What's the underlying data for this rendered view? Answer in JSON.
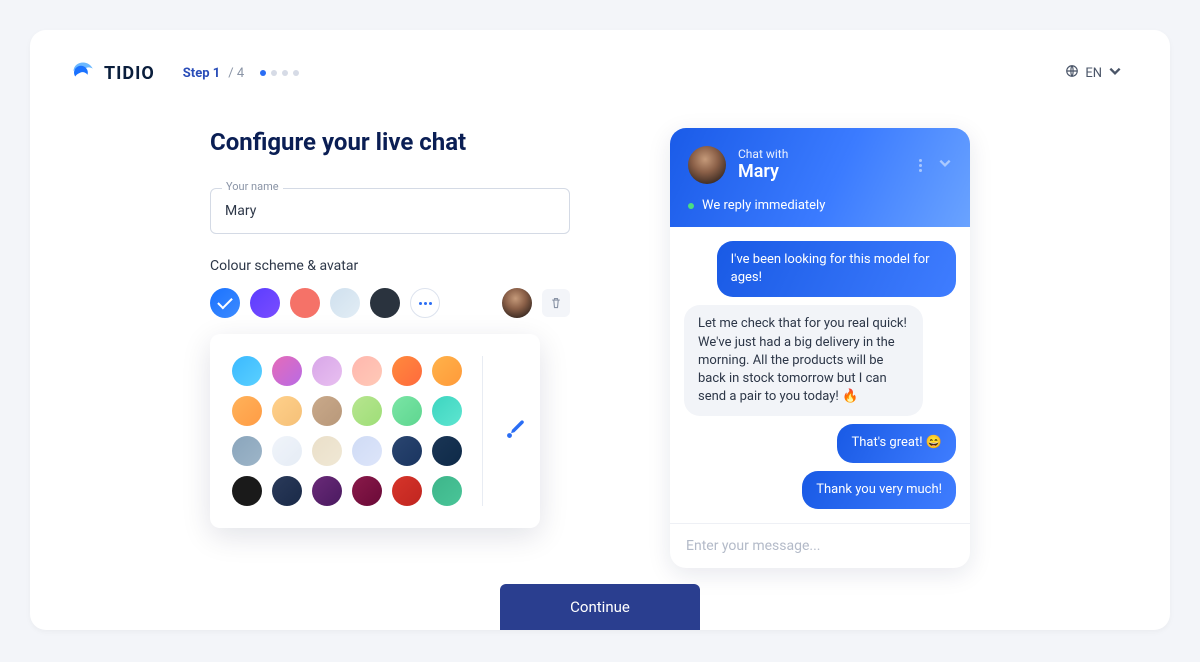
{
  "brand": "TIDIO",
  "step": {
    "label": "Step 1",
    "total": "/ 4",
    "current": 1,
    "count": 4
  },
  "lang": "EN",
  "heading": "Configure your live chat",
  "nameField": {
    "label": "Your name",
    "value": "Mary"
  },
  "colourLabel": "Colour scheme & avatar",
  "primarySwatches": [
    {
      "css": "linear-gradient(135deg,#1a72ff,#3d8bff)",
      "selected": true
    },
    {
      "css": "linear-gradient(135deg,#5b3dff,#7a4dff)"
    },
    {
      "css": "#f57268"
    },
    {
      "css": "linear-gradient(135deg,#cfe0ee,#e2edf5)"
    },
    {
      "css": "#2a333e"
    }
  ],
  "paletteSwatches": [
    "linear-gradient(135deg,#3bb9ff,#5ad0ff)",
    "linear-gradient(135deg,#e56bb8,#b86be5)",
    "linear-gradient(135deg,#d8a6e8,#e8bff0)",
    "linear-gradient(135deg,#ffb7ae,#ffc9b7)",
    "linear-gradient(135deg,#ff8a3d,#ff6a3d)",
    "linear-gradient(135deg,#ffb24a,#ff9a3a)",
    "linear-gradient(135deg,#ffb25a,#ff9c45)",
    "linear-gradient(135deg,#ffd08a,#f5c078)",
    "linear-gradient(135deg,#c9a98a,#b8987a)",
    "linear-gradient(135deg,#b7e58f,#9ede78)",
    "linear-gradient(135deg,#7ae5a5,#5ed690)",
    "linear-gradient(135deg,#3dd5c0,#5ee5d0)",
    "linear-gradient(135deg,#8aa5bc,#9db5c8)",
    "linear-gradient(135deg,#f0f4fa,#e5ecf5)",
    "linear-gradient(135deg,#eadfc9,#f0e8d5)",
    "linear-gradient(135deg,#cfdbf5,#dde5fa)",
    "linear-gradient(135deg,#2a4570,#1a3560)",
    "linear-gradient(135deg,#1a3555,#0e2a48)",
    "#1a1a1a",
    "linear-gradient(135deg,#2a3a5a,#1a2a48)",
    "linear-gradient(135deg,#6a2a78,#4a1a60)",
    "linear-gradient(135deg,#8a1a4a,#6a0a38)",
    "linear-gradient(135deg,#d6352a,#c02520)",
    "linear-gradient(135deg,#3db58a,#4ac598)"
  ],
  "chat": {
    "withLabel": "Chat with",
    "name": "Mary",
    "status": "We reply immediately",
    "messages": [
      {
        "side": "out",
        "text": "I've been looking for this model for ages!"
      },
      {
        "side": "in",
        "text": "Let me check that for you real quick! We've just had a big delivery in the morning. All the products will be back in stock tomorrow but I can send a pair to you today! 🔥"
      },
      {
        "side": "out",
        "text": "That's great! 😄"
      },
      {
        "side": "out",
        "text": "Thank you very much!"
      }
    ],
    "placeholder": "Enter your message..."
  },
  "continueLabel": "Continue"
}
